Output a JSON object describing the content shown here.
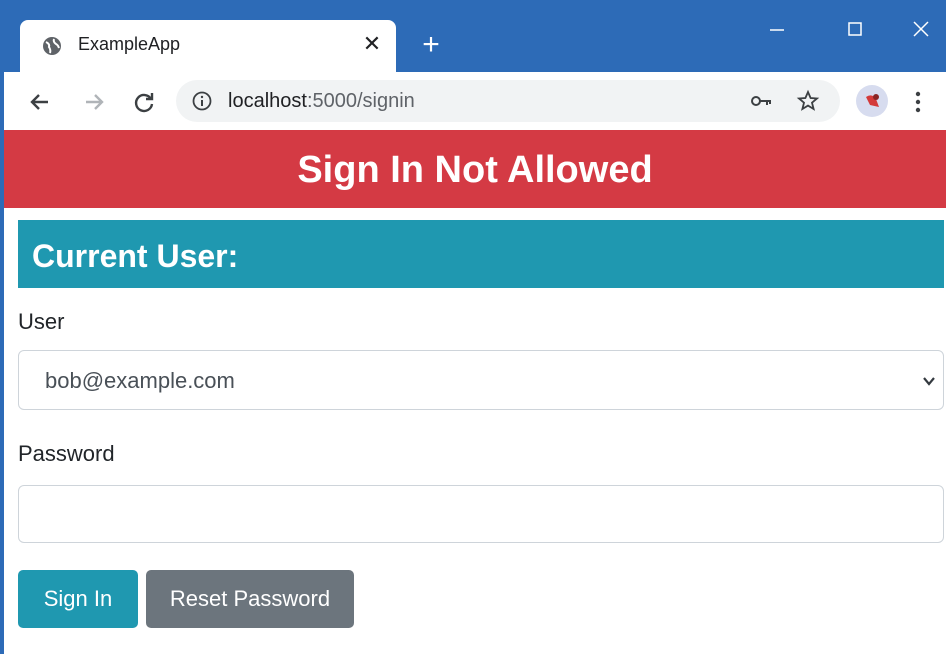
{
  "browser": {
    "tab_title": "ExampleApp",
    "tab_close": "✕",
    "new_tab": "+",
    "url_host": "localhost",
    "url_path": ":5000/signin",
    "accent_color": "#2d6bb7"
  },
  "page": {
    "banner_text": "Sign In Not Allowed",
    "banner_color": "#d43a44",
    "section_title": "Current User:",
    "section_color": "#1f98b0",
    "user_label": "User",
    "user_selected": "bob@example.com",
    "password_label": "Password",
    "password_value": "",
    "signin_label": "Sign In",
    "reset_label": "Reset Password"
  }
}
